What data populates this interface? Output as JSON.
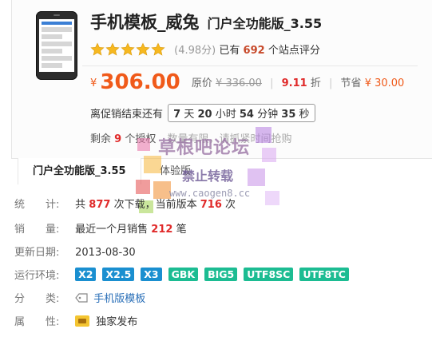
{
  "product": {
    "title": "手机模板_威兔",
    "edition": "门户全功能版_3.55",
    "rating": {
      "stars": 5,
      "score_text": "(4.98分)",
      "rated_prefix": "已有",
      "rated_count": "692",
      "rated_suffix": "个站点评分"
    },
    "price": {
      "currency": "¥",
      "current": "306.00",
      "orig_label": "原价",
      "orig_value": "¥ 336.00",
      "discount_value": "9.11",
      "discount_suffix": "折",
      "save_label": "节省",
      "save_value": "¥ 30.00"
    },
    "countdown": {
      "prefix": "离促销结束还有",
      "days": "7",
      "days_unit": "天",
      "hours": "20",
      "hours_unit": "小时",
      "minutes": "54",
      "minutes_unit": "分钟",
      "seconds": "35",
      "seconds_unit": "秒"
    },
    "remaining": {
      "prefix": "剩余",
      "count": "9",
      "suffix": "个授权",
      "note": "数量有限，请抓紧时间抢购"
    }
  },
  "tabs": [
    {
      "label": "门户全功能版_3.55",
      "active": true
    },
    {
      "label": "体验版",
      "active": false
    }
  ],
  "watermark": {
    "line1": "草根吧论坛",
    "line2": "禁止转载",
    "line3": "www.caogen8.cc"
  },
  "details": {
    "stats": {
      "label": "统　　计:",
      "prefix": "共",
      "downloads": "877",
      "mid": "次下载，当前版本",
      "version_downloads": "716",
      "suffix": "次"
    },
    "sales": {
      "label": "销　　量:",
      "prefix": "最近一个月销售",
      "count": "212",
      "suffix": "笔"
    },
    "updated": {
      "label": "更新日期:",
      "value": "2013-08-30"
    },
    "env": {
      "label": "运行环境:",
      "tags": [
        "X2",
        "X2.5",
        "X3",
        "GBK",
        "BIG5",
        "UTF8SC",
        "UTF8TC"
      ]
    },
    "category": {
      "label": "分　　类:",
      "value": "手机版模板"
    },
    "attribute": {
      "label": "属　　性:",
      "value": "独家发布"
    }
  },
  "colors": {
    "accent_price": "#f05a1a",
    "accent_red": "#e02a2a",
    "link": "#2a6fb8",
    "tag_blue": "#1a8fd0",
    "tag_green": "#1cbc92",
    "star": "#f6b820"
  }
}
